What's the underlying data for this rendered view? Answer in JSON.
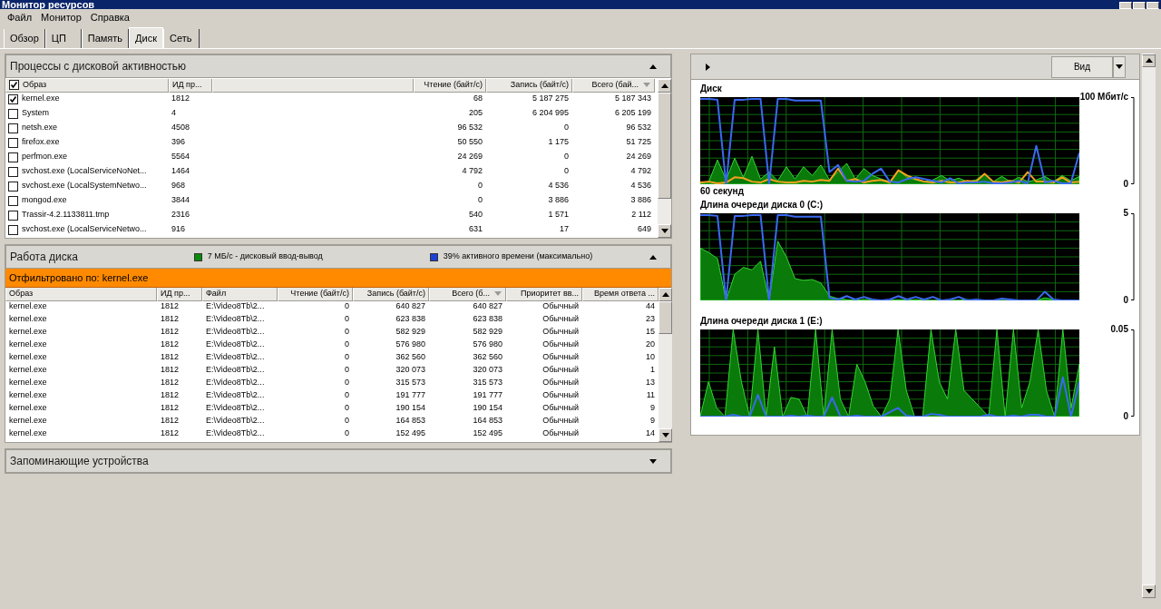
{
  "window": {
    "title": "Монитор ресурсов"
  },
  "menu": [
    "Файл",
    "Монитор",
    "Справка"
  ],
  "tabs": [
    {
      "label": "Обзор",
      "selected": false
    },
    {
      "label": "ЦП",
      "selected": false
    },
    {
      "label": "Память",
      "selected": false
    },
    {
      "label": "Диск",
      "selected": true
    },
    {
      "label": "Сеть",
      "selected": false
    }
  ],
  "processes": {
    "title": "Процессы с дисковой активностью",
    "expanded": true,
    "all_checked": true,
    "columns": [
      {
        "label": "Образ",
        "sorted": false
      },
      {
        "label": "ИД пр...",
        "sorted": false
      },
      {
        "label": "Чтение (байт/с)",
        "sorted": false
      },
      {
        "label": "Запись (байт/с)",
        "sorted": false
      },
      {
        "label": "Всего (бай...",
        "sorted": true
      }
    ],
    "rows": [
      {
        "checked": true,
        "cells": [
          "kernel.exe",
          "1812",
          "68",
          "5 187 275",
          "5 187 343"
        ]
      },
      {
        "checked": false,
        "cells": [
          "System",
          "4",
          "205",
          "6 204 995",
          "6 205 199"
        ]
      },
      {
        "checked": false,
        "cells": [
          "netsh.exe",
          "4508",
          "96 532",
          "0",
          "96 532"
        ]
      },
      {
        "checked": false,
        "cells": [
          "firefox.exe",
          "396",
          "50 550",
          "1 175",
          "51 725"
        ]
      },
      {
        "checked": false,
        "cells": [
          "perfmon.exe",
          "5564",
          "24 269",
          "0",
          "24 269"
        ]
      },
      {
        "checked": false,
        "cells": [
          "svchost.exe (LocalServiceNoNet...",
          "1464",
          "4 792",
          "0",
          "4 792"
        ]
      },
      {
        "checked": false,
        "cells": [
          "svchost.exe (LocalSystemNetwo...",
          "968",
          "0",
          "4 536",
          "4 536"
        ]
      },
      {
        "checked": false,
        "cells": [
          "mongod.exe",
          "3844",
          "0",
          "3 886",
          "3 886"
        ]
      },
      {
        "checked": false,
        "cells": [
          "Trassir-4.2.1133811.tmp",
          "2316",
          "540",
          "1 571",
          "2 112"
        ]
      },
      {
        "checked": false,
        "cells": [
          "svchost.exe (LocalServiceNetwo...",
          "916",
          "631",
          "17",
          "649"
        ]
      }
    ]
  },
  "disk_activity": {
    "title": "Работа диска",
    "expanded": true,
    "legend": [
      {
        "text": "7 МБ/с - дисковый ввод-вывод",
        "color": "#0a8a0a"
      },
      {
        "text": "39% активного времени (максимально)",
        "color": "#1c3fd6"
      }
    ],
    "filter": "Отфильтровано по: kernel.exe",
    "columns": [
      {
        "label": "Образ",
        "sorted": false
      },
      {
        "label": "ИД пр...",
        "sorted": false
      },
      {
        "label": "Файл",
        "sorted": false
      },
      {
        "label": "Чтение (байт/с)",
        "sorted": false
      },
      {
        "label": "Запись (байт/с)",
        "sorted": false
      },
      {
        "label": "Всего (б...",
        "sorted": true
      },
      {
        "label": "Приоритет вв...",
        "sorted": false
      },
      {
        "label": "Время ответа ...",
        "sorted": false
      }
    ],
    "rows": [
      [
        "kernel.exe",
        "1812",
        "E:\\Video8Tb\\2...",
        "0",
        "640 827",
        "640 827",
        "Обычный",
        "44"
      ],
      [
        "kernel.exe",
        "1812",
        "E:\\Video8Tb\\2...",
        "0",
        "623 838",
        "623 838",
        "Обычный",
        "23"
      ],
      [
        "kernel.exe",
        "1812",
        "E:\\Video8Tb\\2...",
        "0",
        "582 929",
        "582 929",
        "Обычный",
        "15"
      ],
      [
        "kernel.exe",
        "1812",
        "E:\\Video8Tb\\2...",
        "0",
        "576 980",
        "576 980",
        "Обычный",
        "20"
      ],
      [
        "kernel.exe",
        "1812",
        "E:\\Video8Tb\\2...",
        "0",
        "362 560",
        "362 560",
        "Обычный",
        "10"
      ],
      [
        "kernel.exe",
        "1812",
        "E:\\Video8Tb\\2...",
        "0",
        "320 073",
        "320 073",
        "Обычный",
        "1"
      ],
      [
        "kernel.exe",
        "1812",
        "E:\\Video8Tb\\2...",
        "0",
        "315 573",
        "315 573",
        "Обычный",
        "13"
      ],
      [
        "kernel.exe",
        "1812",
        "E:\\Video8Tb\\2...",
        "0",
        "191 777",
        "191 777",
        "Обычный",
        "11"
      ],
      [
        "kernel.exe",
        "1812",
        "E:\\Video8Tb\\2...",
        "0",
        "190 154",
        "190 154",
        "Обычный",
        "9"
      ],
      [
        "kernel.exe",
        "1812",
        "E:\\Video8Tb\\2...",
        "0",
        "164 853",
        "164 853",
        "Обычный",
        "9"
      ],
      [
        "kernel.exe",
        "1812",
        "E:\\Video8Tb\\2...",
        "0",
        "152 495",
        "152 495",
        "Обычный",
        "14"
      ]
    ]
  },
  "storage": {
    "title": "Запоминающие устройства",
    "expanded": false
  },
  "graphs_panel": {
    "view_button": "Вид",
    "graphs": [
      {
        "chart_data": {
          "type": "area",
          "title": "Диск",
          "xlabel": "60 секунд",
          "grid": true,
          "ylim": [
            0,
            100
          ],
          "yticks": [
            0,
            {
              "value": 100,
              "label": "100 Мбит/с"
            }
          ],
          "series": [
            {
              "type": "area",
              "color": "#0a7a0a",
              "values": [
                2,
                3,
                28,
                5,
                30,
                8,
                32,
                6,
                14,
                4,
                20,
                6,
                20,
                10,
                22,
                5,
                14,
                24,
                6,
                18,
                10,
                6,
                3,
                16,
                8,
                5,
                3,
                5,
                10,
                4,
                7,
                3,
                5,
                12,
                3,
                9,
                3,
                8,
                3,
                5,
                9,
                3,
                10,
                4,
                9
              ]
            },
            {
              "type": "line",
              "color": "#f5a020",
              "values": [
                2,
                3,
                1,
                2,
                8,
                7,
                3,
                2,
                6,
                3,
                2,
                2,
                4,
                3,
                5,
                4,
                18,
                4,
                6,
                2,
                4,
                5,
                2,
                16,
                10,
                6,
                3,
                2,
                4,
                2,
                2,
                4,
                3,
                12,
                3,
                2,
                4,
                2,
                14,
                3,
                3,
                2,
                8,
                2,
                3
              ]
            },
            {
              "type": "line",
              "color": "#3a6af0",
              "values": [
                98,
                98,
                97,
                0,
                97,
                97,
                98,
                98,
                0,
                98,
                98,
                96,
                96,
                96,
                96,
                14,
                22,
                4,
                3,
                4,
                12,
                18,
                3,
                2,
                6,
                8,
                6,
                4,
                2,
                7,
                1,
                2,
                2,
                3,
                1,
                1,
                2,
                4,
                1,
                44,
                2,
                4,
                1,
                1,
                36
              ]
            }
          ]
        }
      },
      {
        "chart_data": {
          "type": "area",
          "title": "Длина очереди диска 0 (C:)",
          "grid": true,
          "ylim": [
            0,
            5
          ],
          "yticks": [
            0,
            5
          ],
          "series": [
            {
              "type": "area",
              "color": "#0a7a0a",
              "values": [
                3,
                2.75,
                2.4,
                0,
                1.5,
                1.9,
                1.75,
                2.25,
                0,
                3.4,
                2.5,
                1.25,
                1.15,
                1.2,
                1,
                0.25,
                0.1,
                0.05,
                0,
                0.05,
                0.05,
                0,
                0,
                0.05,
                0,
                0.05,
                0,
                0,
                0,
                0,
                0,
                0.05,
                0,
                0,
                0,
                0,
                0,
                0,
                0,
                0,
                0.15,
                0.05,
                0,
                0,
                0
              ]
            },
            {
              "type": "line",
              "color": "#3a6af0",
              "values": [
                4.9,
                4.9,
                4.85,
                0,
                4.85,
                4.85,
                4.9,
                4.9,
                0,
                4.9,
                4.9,
                4.8,
                4.8,
                4.8,
                4.8,
                0.15,
                0.05,
                0.25,
                0.05,
                0.2,
                0.05,
                0,
                0.05,
                0.25,
                0.05,
                0.2,
                0.05,
                0.2,
                0,
                0.05,
                0.2,
                0,
                0.05,
                0,
                0,
                0.1,
                0.05,
                0,
                0,
                0,
                0.5,
                0.05,
                0,
                0,
                0
              ]
            }
          ]
        }
      },
      {
        "chart_data": {
          "type": "area",
          "title": "Длина очереди диска 1 (E:)",
          "grid": true,
          "ylim": [
            0,
            0.05
          ],
          "yticks": [
            0,
            0.05
          ],
          "series": [
            {
              "type": "area",
              "color": "#0a7a0a",
              "values": [
                0,
                0.02,
                0.005,
                0,
                0.05,
                0.02,
                0,
                0.05,
                0,
                0.04,
                0,
                0.011,
                0.01,
                0,
                0.05,
                0,
                0.05,
                0.01,
                0,
                0.03,
                0.02,
                0.006,
                0,
                0.01,
                0.05,
                0.015,
                0,
                0,
                0.05,
                0.02,
                0.01,
                0.05,
                0.015,
                0.01,
                0.005,
                0,
                0.05,
                0,
                0.05,
                0.005,
                0.02,
                0.05,
                0.015,
                0,
                0.05,
                0.005,
                0.03
              ]
            },
            {
              "type": "line",
              "color": "#3a6af0",
              "values": [
                0,
                0,
                0,
                0,
                0.001,
                0,
                0,
                0.0125,
                0,
                0,
                0,
                0.0005,
                0,
                0.0005,
                0,
                0,
                0.011,
                0,
                0,
                0.0005,
                0,
                0,
                0,
                0.0025,
                0.005,
                0.0005,
                0,
                0,
                0.0015,
                0.001,
                0,
                0,
                0,
                0,
                0,
                0.001,
                0,
                0,
                0.0005,
                0,
                0.001,
                0.001,
                0,
                0,
                0.0225,
                0,
                0.02
              ]
            }
          ]
        }
      }
    ]
  }
}
